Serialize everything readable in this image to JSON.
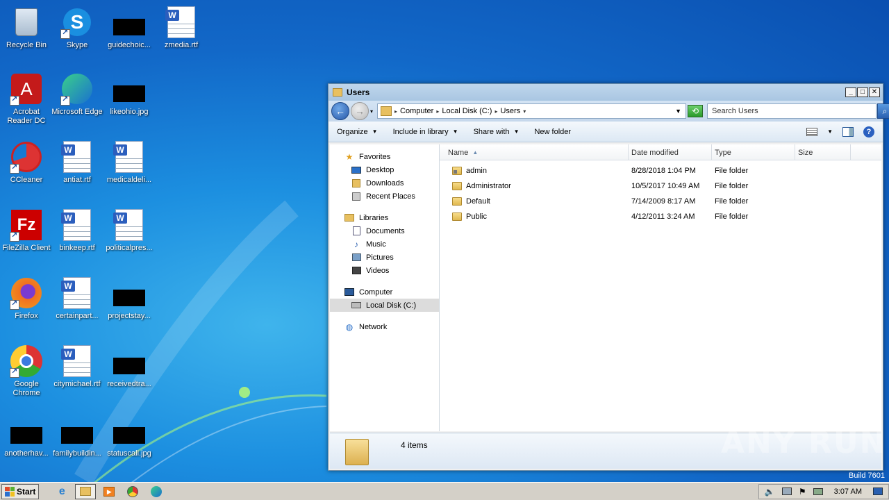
{
  "desktop": {
    "icons": [
      {
        "label": "Recycle Bin",
        "icon": "recycle-bin-icon"
      },
      {
        "label": "Skype",
        "icon": "skype-icon"
      },
      {
        "label": "guidechoic...",
        "icon": "black-thumbnail-icon"
      },
      {
        "label": "zmedia.rtf",
        "icon": "word-document-icon"
      },
      {
        "label": "Acrobat Reader DC",
        "icon": "acrobat-icon"
      },
      {
        "label": "Microsoft Edge",
        "icon": "edge-icon"
      },
      {
        "label": "likeohio.jpg",
        "icon": "black-thumbnail-icon"
      },
      {
        "label": "CCleaner",
        "icon": "ccleaner-icon"
      },
      {
        "label": "antiat.rtf",
        "icon": "word-document-icon"
      },
      {
        "label": "medicaldeli...",
        "icon": "word-document-icon"
      },
      {
        "label": "FileZilla Client",
        "icon": "filezilla-icon"
      },
      {
        "label": "binkeep.rtf",
        "icon": "word-document-icon"
      },
      {
        "label": "politicalpres...",
        "icon": "word-document-icon"
      },
      {
        "label": "Firefox",
        "icon": "firefox-icon"
      },
      {
        "label": "certainpart...",
        "icon": "word-document-icon"
      },
      {
        "label": "projectstay...",
        "icon": "black-thumbnail-icon"
      },
      {
        "label": "Google Chrome",
        "icon": "chrome-icon"
      },
      {
        "label": "citymichael.rtf",
        "icon": "word-document-icon"
      },
      {
        "label": "receivedtra...",
        "icon": "black-thumbnail-icon"
      },
      {
        "label": "anotherhav...",
        "icon": "black-thumbnail-icon"
      },
      {
        "label": "familybuildin...",
        "icon": "black-thumbnail-icon"
      },
      {
        "label": "statuscall.jpg",
        "icon": "black-thumbnail-icon"
      }
    ]
  },
  "window": {
    "title": "Users",
    "breadcrumb": [
      "Computer",
      "Local Disk (C:)",
      "Users"
    ],
    "search_placeholder": "Search Users",
    "toolbar": {
      "organize": "Organize",
      "include_in_library": "Include in library",
      "share_with": "Share with",
      "new_folder": "New folder"
    },
    "nav": {
      "favorites": "Favorites",
      "desktop": "Desktop",
      "downloads": "Downloads",
      "recent_places": "Recent Places",
      "libraries": "Libraries",
      "documents": "Documents",
      "music": "Music",
      "pictures": "Pictures",
      "videos": "Videos",
      "computer": "Computer",
      "local_disk": "Local Disk (C:)",
      "network": "Network"
    },
    "columns": {
      "name": "Name",
      "date_modified": "Date modified",
      "type": "Type",
      "size": "Size"
    },
    "rows": [
      {
        "name": "admin",
        "date": "8/28/2018 1:04 PM",
        "type": "File folder"
      },
      {
        "name": "Administrator",
        "date": "10/5/2017 10:49 AM",
        "type": "File folder"
      },
      {
        "name": "Default",
        "date": "7/14/2009 8:17 AM",
        "type": "File folder"
      },
      {
        "name": "Public",
        "date": "4/12/2011 3:24 AM",
        "type": "File folder"
      }
    ],
    "status": "4 items"
  },
  "watermark": "ANY RUN",
  "build": "Build 7601",
  "taskbar": {
    "start": "Start",
    "clock": "3:07 AM"
  }
}
